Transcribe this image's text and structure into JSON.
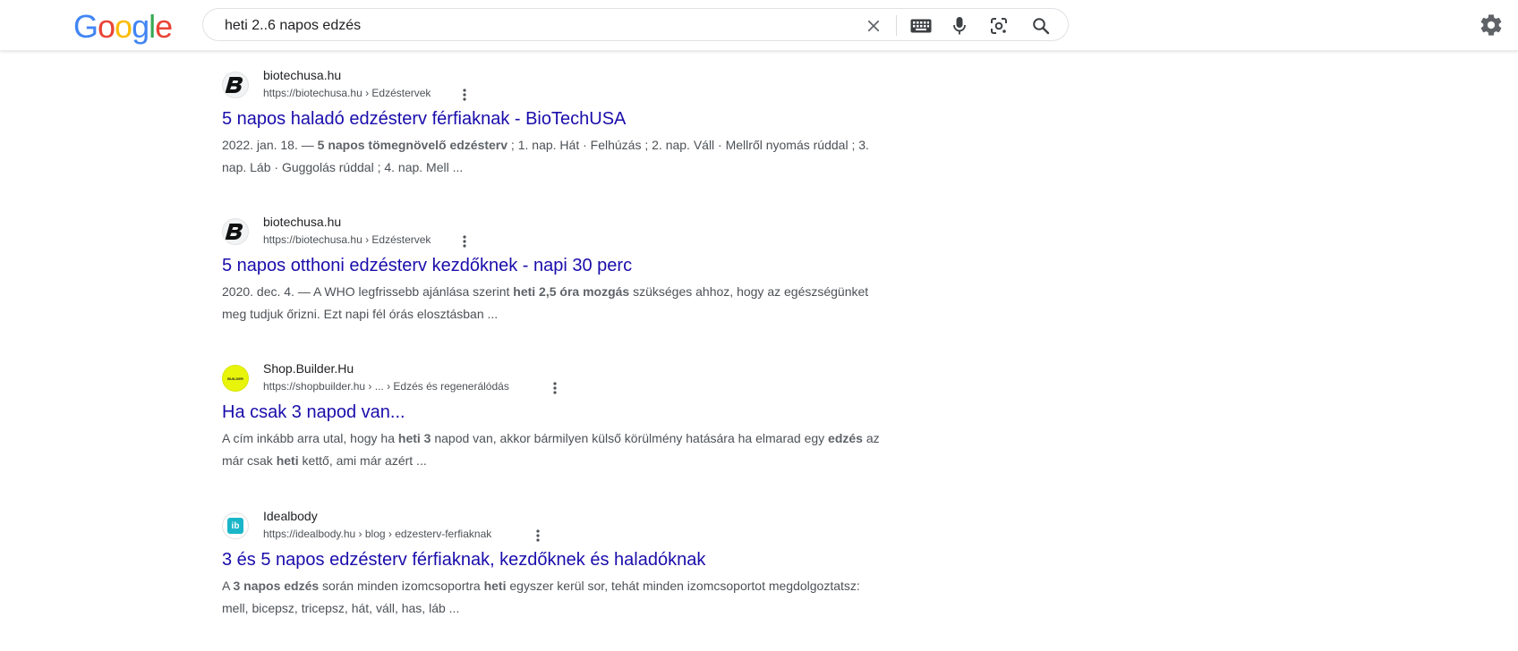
{
  "search": {
    "query": "heti 2..6 napos edzés"
  },
  "logo": {
    "letters": [
      "G",
      "o",
      "o",
      "g",
      "l",
      "e"
    ],
    "colors": [
      "#4285F4",
      "#EA4335",
      "#FBBC05",
      "#4285F4",
      "#34A853",
      "#EA4335"
    ]
  },
  "icons": {
    "clear": "close-icon",
    "keyboard": "keyboard-icon",
    "voice": "microphone-icon",
    "lens": "lens-icon",
    "search": "search-icon",
    "settings": "gear-icon"
  },
  "results": [
    {
      "site_name": "biotechusa.hu",
      "url": "https://biotechusa.hu › Edzéstervek",
      "title": "5 napos haladó edzésterv férfiaknak - BioTechUSA",
      "snippet": [
        {
          "t": "2022. jan. 18. — "
        },
        {
          "t": "5 napos tömegnövelő edzésterv",
          "b": true
        },
        {
          "t": " ; 1. nap. Hát · Felhúzás ; 2. nap. Váll · Mellről nyomás rúddal ; 3. nap. Láb · Guggolás rúddal ; 4. nap. Mell ..."
        }
      ]
    },
    {
      "site_name": "biotechusa.hu",
      "url": "https://biotechusa.hu › Edzéstervek",
      "title": "5 napos otthoni edzésterv kezdőknek - napi 30 perc",
      "snippet": [
        {
          "t": "2020. dec. 4. — A WHO legfrissebb ajánlása szerint "
        },
        {
          "t": "heti 2,5 óra mozgás",
          "b": true
        },
        {
          "t": " szükséges ahhoz, hogy az egészségünket meg tudjuk őrizni. Ezt napi fél órás elosztásban ..."
        }
      ]
    },
    {
      "site_name": "Shop.Builder.Hu",
      "url": "https://shopbuilder.hu › ... › Edzés és regenerálódás",
      "title": "Ha csak 3 napod van...",
      "snippet": [
        {
          "t": "A cím inkább arra utal, hogy ha "
        },
        {
          "t": "heti 3",
          "b": true
        },
        {
          "t": " napod van, akkor bármilyen külső körülmény hatására ha elmarad egy "
        },
        {
          "t": "edzés",
          "b": true
        },
        {
          "t": " az már csak "
        },
        {
          "t": "heti",
          "b": true
        },
        {
          "t": " kettő, ami már azért ..."
        }
      ]
    },
    {
      "site_name": "Idealbody",
      "url": "https://idealbody.hu › blog › edzesterv-ferfiaknak",
      "title": "3 és 5 napos edzésterv férfiaknak, kezdőknek és haladóknak",
      "snippet": [
        {
          "t": "A "
        },
        {
          "t": "3 napos edzés",
          "b": true
        },
        {
          "t": " során minden izomcsoportra "
        },
        {
          "t": "heti",
          "b": true
        },
        {
          "t": " egyszer kerül sor, tehát minden izomcsoportot megdolgoztatsz: mell, bicepsz, tricepsz, hát, váll, has, láb ..."
        }
      ]
    }
  ],
  "favicon_labels": {
    "builder": "BUILDER",
    "idealbody": "ib"
  },
  "colors": {
    "link": "#1a0dab",
    "snippet": "#4d5156",
    "builder_favicon": "#e8f50a",
    "idealbody_favicon": "#1ab6c8"
  }
}
